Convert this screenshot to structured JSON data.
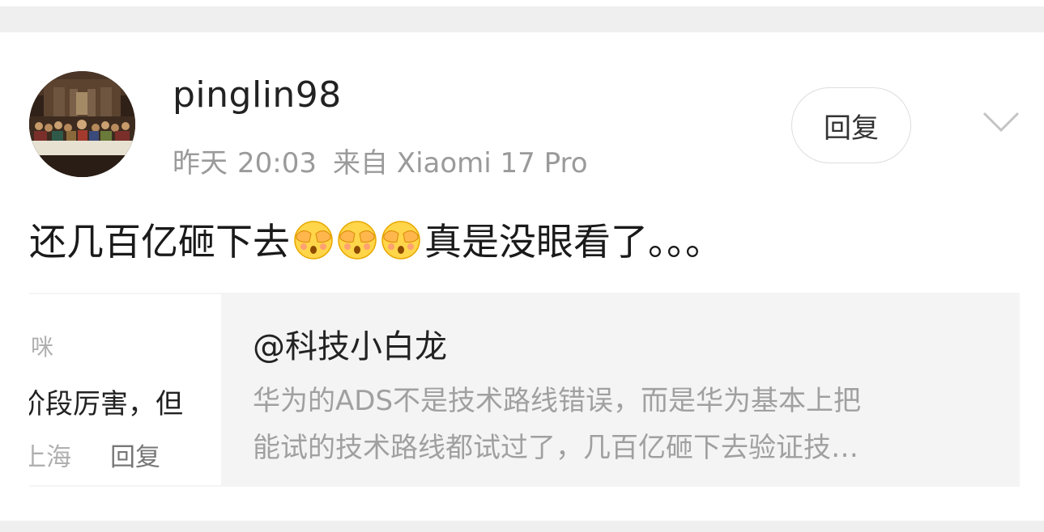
{
  "post": {
    "username": "pinglin98",
    "day": "昨天",
    "time": "20:03",
    "source": "来自 Xiaomi 17 Pro",
    "reply_label": "回复",
    "comment_before": "还几百亿砸下去",
    "emoji_name": "face-covering-eyes-emoji",
    "emoji_count": 3,
    "comment_after": "真是没眼看了。。。"
  },
  "quote": {
    "thumb": {
      "line1": "咪",
      "line2": "阶段厉害，但",
      "location": "上海",
      "reply_label": "回复"
    },
    "author": "@科技小白龙",
    "line1": "华为的ADS不是技术路线错误，而是华为基本上把",
    "line2": "能试的技术路线都试过了，几百亿砸下去验证技…"
  },
  "icons": {
    "avatar": "last-supper-painting-avatar",
    "chevron": "chevron-down-icon"
  },
  "colors": {
    "card": "#ffffff",
    "page_bg": "#efefef",
    "meta": "#9a9a9a",
    "quote_bg": "#f4f4f4"
  }
}
